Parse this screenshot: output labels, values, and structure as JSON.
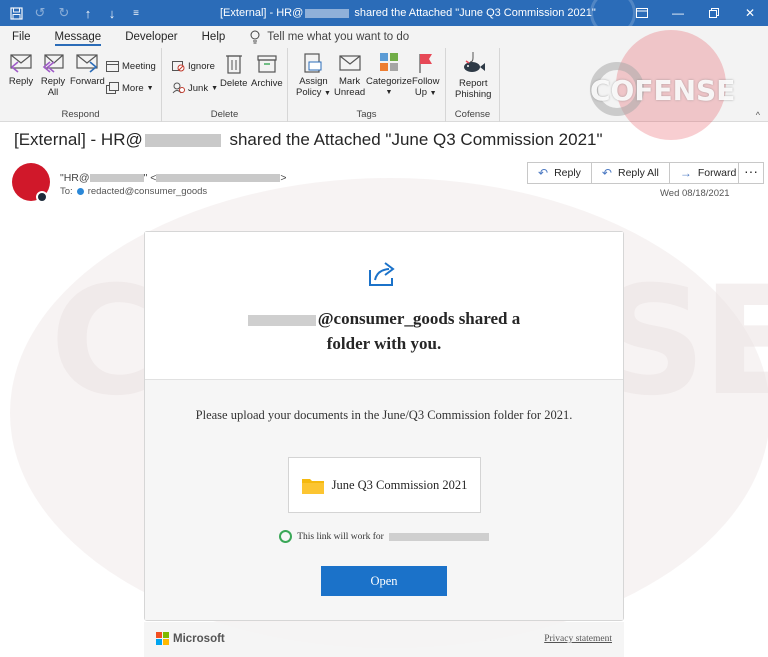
{
  "window": {
    "title_prefix": "[External] - HR@",
    "title_suffix": " shared the Attached \"June Q3 Commission 2021\""
  },
  "menu": {
    "tabs": [
      "File",
      "Message",
      "Developer",
      "Help"
    ],
    "active_tab": "Message",
    "tell_me": "Tell me what you want to do"
  },
  "ribbon": {
    "respond": {
      "label": "Respond",
      "reply": "Reply",
      "reply_all_1": "Reply",
      "reply_all_2": "All",
      "forward": "Forward",
      "meeting": "Meeting",
      "more": "More"
    },
    "delete": {
      "label": "Delete",
      "ignore": "Ignore",
      "junk": "Junk",
      "delete": "Delete",
      "archive": "Archive"
    },
    "tags": {
      "label": "Tags",
      "assign_1": "Assign",
      "assign_2": "Policy",
      "mark_1": "Mark",
      "mark_2": "Unread",
      "categorize": "Categorize",
      "follow_1": "Follow",
      "follow_2": "Up"
    },
    "cofense": {
      "label": "Cofense",
      "report_1": "Report",
      "report_2": "Phishing"
    }
  },
  "logo": {
    "text": "COFENSE",
    "color": "#e6505a"
  },
  "email": {
    "subject_prefix": "[External] - HR@",
    "subject_suffix": " shared the Attached \"June Q3 Commission 2021\"",
    "sender_prefix": "\"HR@",
    "sender_middle": "\" <",
    "sender_suffix": ">",
    "to_label": "To:",
    "to_address": "redacted@consumer_goods",
    "date": "Wed 08/18/2021",
    "actions": {
      "reply": "Reply",
      "reply_all": "Reply All",
      "forward": "Forward",
      "more": "···"
    }
  },
  "card": {
    "heading_1": "@consumer_goods shared a",
    "heading_2": "folder with you.",
    "message": "Please upload your documents in the June/Q3 Commission folder for 2021.",
    "folder_name": "June Q3 Commission 2021",
    "link_note": "This link will work for",
    "open_button": "Open",
    "accent": "#1b72c9"
  },
  "footer": {
    "brand": "Microsoft",
    "privacy": "Privacy statement"
  }
}
